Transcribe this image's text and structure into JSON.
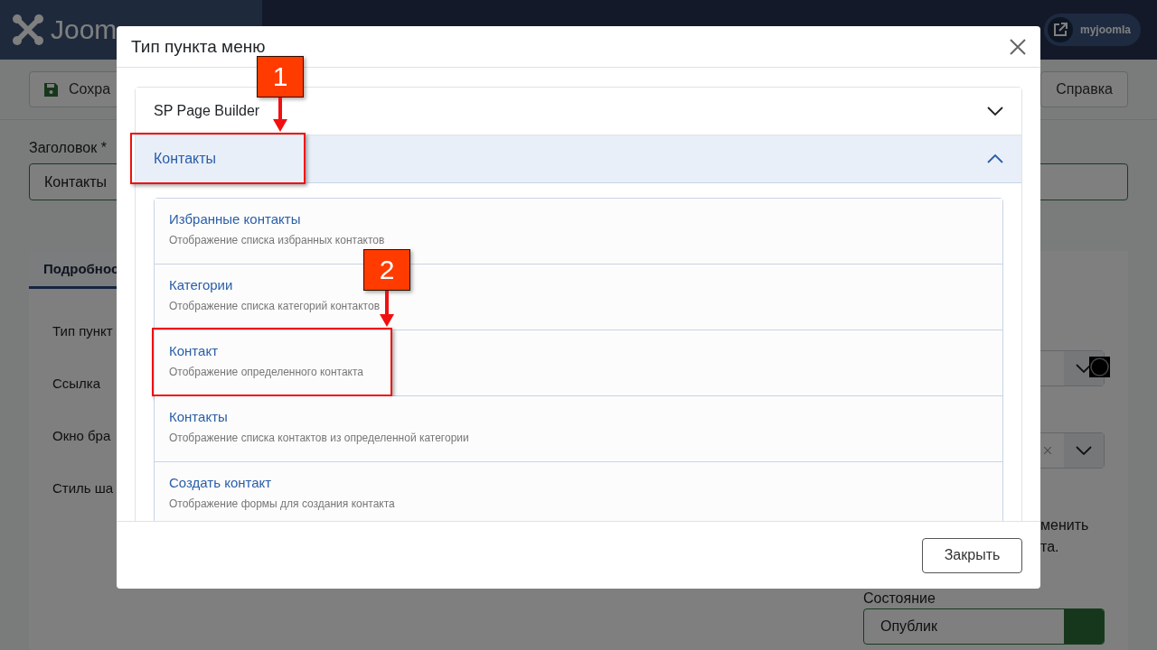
{
  "header": {
    "logo_text": "Joom",
    "user_button": "myjoomla"
  },
  "toolbar": {
    "save_button": "Сохра",
    "help_button": "Справка"
  },
  "title_field": {
    "label": "Заголовок *",
    "value": "Контакты"
  },
  "details_tab": {
    "label": "Подробнос",
    "selected": true
  },
  "form_labels": [
    "Тип пункт",
    "Ссылка",
    "Окно бра",
    "Стиль ша"
  ],
  "side_panel": {
    "note_lines": [
      "менить",
      "та."
    ],
    "status_label": "Состояние",
    "status_value": "Опублик"
  },
  "modal": {
    "title": "Тип пункта меню",
    "sections": [
      {
        "title": "SP Page Builder",
        "expanded": false,
        "highlighted": false
      },
      {
        "title": "Контакты",
        "expanded": true,
        "highlighted": true,
        "items": [
          {
            "title": "Избранные контакты",
            "description": "Отображение списка избранных контактов",
            "highlighted": false
          },
          {
            "title": "Категории",
            "description": "Отображение списка категорий контактов",
            "highlighted": false
          },
          {
            "title": "Контакт",
            "description": "Отображение определенного контакта",
            "highlighted": true
          },
          {
            "title": "Контакты",
            "description": "Отображение списка контактов из определенной категории",
            "highlighted": false
          },
          {
            "title": "Создать контакт",
            "description": "Отображение формы для создания контакта",
            "highlighted": false
          }
        ]
      }
    ],
    "close_button": "Закрыть"
  },
  "annotations": [
    {
      "label": "1"
    },
    {
      "label": "2"
    }
  ]
}
